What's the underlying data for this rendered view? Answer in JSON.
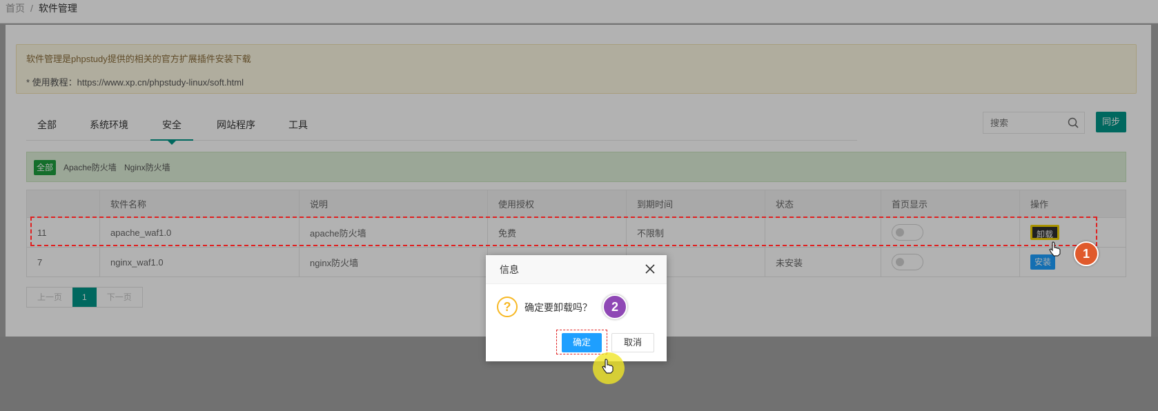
{
  "breadcrumb": {
    "home": "首页",
    "separator": "/",
    "current": "软件管理"
  },
  "notice": {
    "line1": "软件管理是phpstudy提供的相关的官方扩展插件安装下载",
    "line2": "* 使用教程：https://www.xp.cn/phpstudy-linux/soft.html"
  },
  "tabs": [
    {
      "label": "全部"
    },
    {
      "label": "系统环境"
    },
    {
      "label": "安全",
      "active": true
    },
    {
      "label": "网站程序"
    },
    {
      "label": "工具"
    }
  ],
  "search": {
    "placeholder": "搜索"
  },
  "sync_label": "同步",
  "filter": {
    "all": "全部",
    "items": [
      "Apache防火墙",
      "Nginx防火墙"
    ]
  },
  "table": {
    "headers": [
      "",
      "软件名称",
      "说明",
      "使用授权",
      "到期时间",
      "状态",
      "首页显示",
      "操作"
    ],
    "rows": [
      {
        "id": "11",
        "name": "apache_waf1.0",
        "desc": "apache防火墙",
        "license": "免费",
        "expire": "不限制",
        "status": "",
        "action": "卸载"
      },
      {
        "id": "7",
        "name": "nginx_waf1.0",
        "desc": "nginx防火墙",
        "license": "",
        "expire": "",
        "status": "未安装",
        "action": "安装"
      }
    ]
  },
  "pager": {
    "prev": "上一页",
    "current": "1",
    "next": "下一页"
  },
  "dialog": {
    "title": "信息",
    "message": "确定要卸载吗？",
    "ok": "确定",
    "cancel": "取消"
  },
  "badges": {
    "one": "1",
    "two": "2"
  },
  "colors": {
    "accent": "#009688",
    "primary_btn": "#1e9fff",
    "notice_bg": "#fcf8e3",
    "filter_bg": "#dff0d8",
    "badge1": "#e05a2c",
    "badge2": "#8f48b5"
  }
}
